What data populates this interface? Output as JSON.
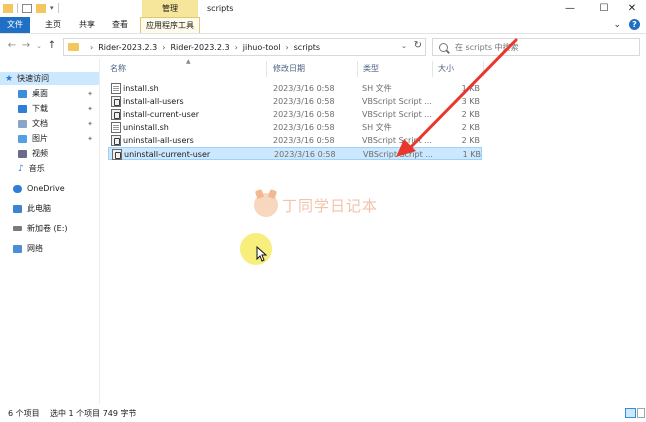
{
  "window": {
    "manage_tab": "管理",
    "title": "scripts",
    "minimize": "—",
    "maximize": "☐",
    "close": "✕"
  },
  "ribbon": {
    "file": "文件",
    "home": "主页",
    "share": "共享",
    "view": "查看",
    "app_tools": "应用程序工具",
    "expand": "⌄",
    "help": "?"
  },
  "nav": {
    "back": "←",
    "forward": "→",
    "recent": "⌄",
    "up": "↑",
    "breadcrumbs": [
      "Rider-2023.2.3",
      "Rider-2023.2.3",
      "jihuo-tool",
      "scripts"
    ],
    "search_placeholder": "在 scripts 中搜索"
  },
  "navpane": {
    "items": [
      {
        "label": "快速访问",
        "icon": "star-icon",
        "selected": true
      },
      {
        "label": "桌面",
        "icon": "desktop-icon",
        "pinned": true
      },
      {
        "label": "下载",
        "icon": "download-icon",
        "pinned": true
      },
      {
        "label": "文档",
        "icon": "documents-icon",
        "pinned": true
      },
      {
        "label": "图片",
        "icon": "pictures-icon",
        "pinned": true
      },
      {
        "label": "视频",
        "icon": "video-icon"
      },
      {
        "label": "音乐",
        "icon": "music-icon"
      },
      {
        "label": "OneDrive",
        "icon": "cloud-icon"
      },
      {
        "label": "此电脑",
        "icon": "computer-icon"
      },
      {
        "label": "新加卷 (E:)",
        "icon": "drive-icon"
      },
      {
        "label": "网络",
        "icon": "network-icon"
      }
    ]
  },
  "columns": {
    "name": "名称",
    "date": "修改日期",
    "type": "类型",
    "size": "大小"
  },
  "files": [
    {
      "name": "install.sh",
      "date": "2023/3/16 0:58",
      "type": "SH 文件",
      "size": "1 KB",
      "icon": "sh-file-icon"
    },
    {
      "name": "install-all-users",
      "date": "2023/3/16 0:58",
      "type": "VBScript Script ...",
      "size": "3 KB",
      "icon": "vbs-file-icon"
    },
    {
      "name": "install-current-user",
      "date": "2023/3/16 0:58",
      "type": "VBScript Script ...",
      "size": "2 KB",
      "icon": "vbs-file-icon"
    },
    {
      "name": "uninstall.sh",
      "date": "2023/3/16 0:58",
      "type": "SH 文件",
      "size": "2 KB",
      "icon": "sh-file-icon"
    },
    {
      "name": "uninstall-all-users",
      "date": "2023/3/16 0:58",
      "type": "VBScript Script ...",
      "size": "2 KB",
      "icon": "vbs-file-icon"
    },
    {
      "name": "uninstall-current-user",
      "date": "2023/3/16 0:58",
      "type": "VBScript Script ...",
      "size": "1 KB",
      "icon": "vbs-file-icon",
      "selected": true
    }
  ],
  "watermark": "丁同学日记本",
  "status": {
    "item_count": "6 个项目",
    "selection": "选中 1 个项目  749 字节"
  },
  "colors": {
    "accent": "#1f6fc4",
    "selection": "#cce8ff",
    "manage_tab": "#f6e69b",
    "annotation_arrow": "#e8372c",
    "cursor_highlight": "#f6e850"
  }
}
